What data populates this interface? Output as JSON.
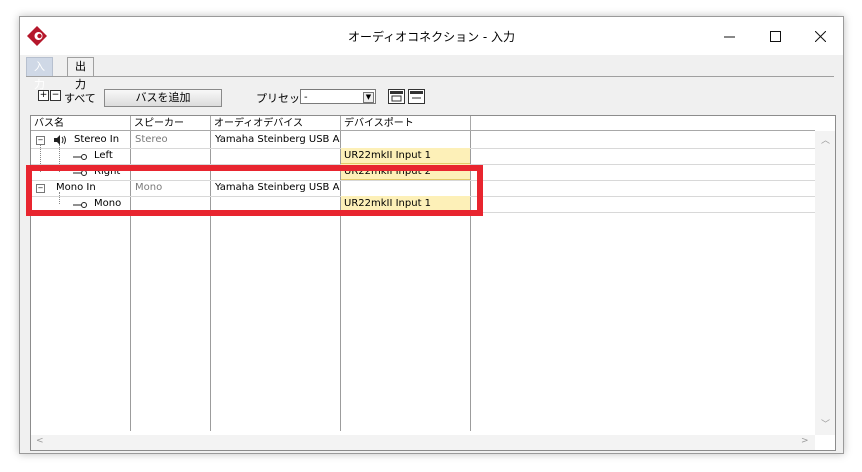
{
  "window": {
    "title": "オーディオコネクション - 入力"
  },
  "tabs": [
    {
      "label": "入力",
      "active": true
    },
    {
      "label": "出力",
      "active": false
    }
  ],
  "toolbar": {
    "all_label": "すべて",
    "add_bus_label": "バスを追加",
    "preset_label": "プリセット",
    "preset_value": "-"
  },
  "table": {
    "headers": [
      "バス名",
      "スピーカー",
      "オーディオデバイス",
      "デバイスポート"
    ],
    "rows": [
      {
        "bus": "Stereo In",
        "speaker": "Stereo",
        "device": "Yamaha Steinberg USB AS",
        "port": ""
      },
      {
        "bus": "Left",
        "speaker": "",
        "device": "",
        "port": "UR22mkII Input 1"
      },
      {
        "bus": "Right",
        "speaker": "",
        "device": "",
        "port": "UR22mkII Input 2"
      },
      {
        "bus": "Mono In",
        "speaker": "Mono",
        "device": "Yamaha Steinberg USB AS",
        "port": ""
      },
      {
        "bus": "Mono",
        "speaker": "",
        "device": "",
        "port": "UR22mkII Input 1"
      }
    ]
  },
  "colors": {
    "highlight": "#e8252f",
    "port_fill": "#fdf0b8",
    "logo": "#b5172b"
  },
  "icons": [
    "cubase-logo-icon",
    "minimize-icon",
    "maximize-icon",
    "close-icon",
    "expand-all-icon",
    "collapse-all-icon",
    "speaker-icon",
    "connector-icon",
    "save-preset-icon",
    "delete-preset-icon"
  ]
}
